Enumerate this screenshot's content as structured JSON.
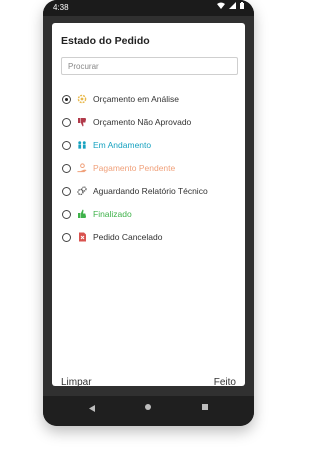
{
  "status": {
    "time": "4:38"
  },
  "dialog": {
    "title": "Estado do Pedido",
    "search_placeholder": "Procurar",
    "options": [
      {
        "label": "Orçamento em Análise",
        "color": "#333333",
        "icon": "gear-clock-icon",
        "icon_color": "#e8b84a",
        "selected": true
      },
      {
        "label": "Orçamento Não Aprovado",
        "color": "#333333",
        "icon": "thumbs-down-icon",
        "icon_color": "#b13a4a",
        "selected": false
      },
      {
        "label": "Em Andamento",
        "color": "#17a2c0",
        "icon": "workers-icon",
        "icon_color": "#17a2c0",
        "selected": false
      },
      {
        "label": "Pagamento Pendente",
        "color": "#f0a07a",
        "icon": "hand-coins-icon",
        "icon_color": "#f0a07a",
        "selected": false
      },
      {
        "label": "Aguardando Relatório Técnico",
        "color": "#333333",
        "icon": "gears-icon",
        "icon_color": "#555555",
        "selected": false
      },
      {
        "label": "Finalizado",
        "color": "#3fb24a",
        "icon": "thumbs-up-icon",
        "icon_color": "#3fb24a",
        "selected": false
      },
      {
        "label": "Pedido Cancelado",
        "color": "#333333",
        "icon": "cancel-document-icon",
        "icon_color": "#d9534f",
        "selected": false
      }
    ],
    "clear_label": "Limpar",
    "done_label": "Feito"
  }
}
